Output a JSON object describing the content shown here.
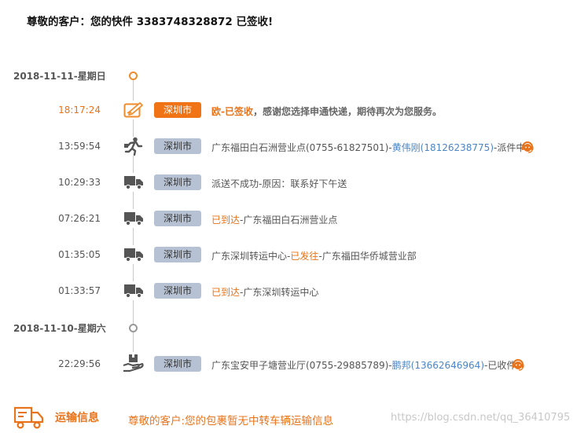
{
  "headline": {
    "prefix": "尊敬的客户：您的快件 ",
    "tracking_number": "3383748328872",
    "suffix": " 已签收!"
  },
  "dates": [
    {
      "label": "2018-11-11-星期日",
      "active": true
    },
    {
      "label": "2018-11-10-星期六",
      "active": false
    }
  ],
  "entries": [
    {
      "time": "18:17:24",
      "city": "深圳市",
      "icon": "signed-icon",
      "active": true,
      "desc": {
        "status": "欧-已签收",
        "text": "，感谢您选择申通快递，期待再次为您服务。"
      }
    },
    {
      "time": "13:59:54",
      "city": "深圳市",
      "icon": "courier-running-icon",
      "active": false,
      "desc": {
        "pre": "广东福田白石洲营业点(0755-61827501)-",
        "courier": "黄伟刚(18126238775)",
        "post": "-派件中"
      },
      "has_courier_icon": true
    },
    {
      "time": "10:29:33",
      "city": "深圳市",
      "icon": "truck-icon",
      "active": false,
      "desc": {
        "text": "派送不成功-原因：联系好下午送"
      }
    },
    {
      "time": "07:26:21",
      "city": "深圳市",
      "icon": "truck-icon",
      "active": false,
      "desc": {
        "status": "已到达",
        "text": "-广东福田白石洲营业点"
      }
    },
    {
      "time": "01:35:05",
      "city": "深圳市",
      "icon": "truck-icon",
      "active": false,
      "desc": {
        "pre": "广东深圳转运中心-",
        "status": "已发往",
        "text": "-广东福田华侨城营业部"
      }
    },
    {
      "time": "01:33:57",
      "city": "深圳市",
      "icon": "truck-icon",
      "active": false,
      "desc": {
        "status": "已到达",
        "text": "-广东深圳转运中心"
      }
    },
    {
      "time": "22:29:56",
      "city": "深圳市",
      "icon": "package-pickup-icon",
      "active": false,
      "desc": {
        "pre": "广东宝安甲子塘营业厅(0755-29885789)-",
        "courier": "鹏邦(13662646964)",
        "post": "-已收件"
      },
      "has_courier_icon": true
    }
  ],
  "footer": {
    "title": "运输信息",
    "message": "尊敬的客户:您的包裹暂无中转车辆运输信息",
    "watermark": "https://blog.csdn.net/qq_36410795"
  },
  "colors": {
    "accent": "#e8731a",
    "tag_active": "#f07416",
    "tag_default": "#b6c2d3",
    "link": "#4a86c8"
  }
}
